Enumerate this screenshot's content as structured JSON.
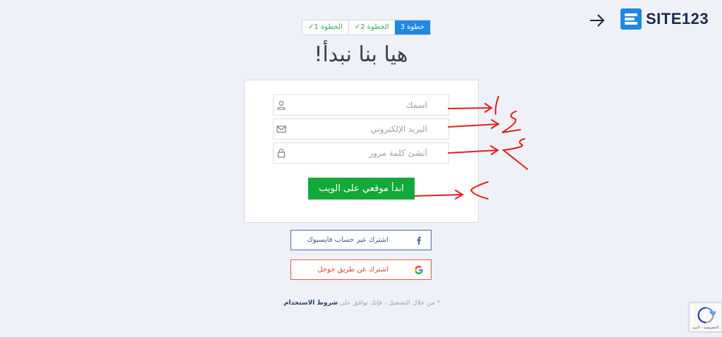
{
  "header": {
    "logo_text": "SITE123",
    "back_icon": "arrow-right-icon"
  },
  "steps": [
    {
      "label": "الخطوة 1",
      "done": true
    },
    {
      "label": "الخطوة 2",
      "done": true
    },
    {
      "label": "خطوة 3",
      "done": false
    }
  ],
  "title": "هيا بنا نبدأ!",
  "form": {
    "name_placeholder": "اسمك",
    "email_placeholder": "البريد الإلكتروني",
    "password_placeholder": "أنشئ كلمة مرور",
    "submit_label": "ابدأ موقعي على الويب"
  },
  "social": {
    "facebook_label": "اشترك عبر حساب فايسبوك",
    "google_label": "اشترك عن طريق جوجل"
  },
  "terms": {
    "prefix": "* من خلال التسجيل ، فإنك توافق على",
    "link": "شروط الاستخدام",
    "suffix": "."
  },
  "recaptcha": {
    "footer": "الخصوصية - البنود"
  },
  "annotations": [
    "1",
    "2",
    "3",
    "4"
  ],
  "colors": {
    "brand": "#1e88e5",
    "submit": "#13a83a",
    "facebook": "#3b5998",
    "google": "#d44638",
    "annotation": "#e0201c"
  }
}
